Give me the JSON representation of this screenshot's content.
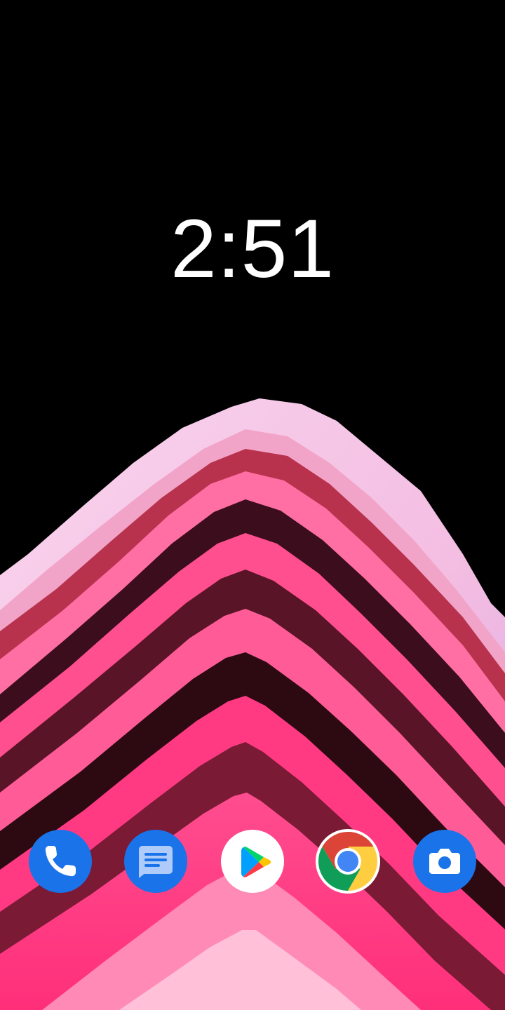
{
  "lockscreen": {
    "clock": "2:51"
  },
  "wallpaper": {
    "description_colors": {
      "background": "#000000",
      "rim": "#f6c6e6",
      "band_light": "#ff5a99",
      "band_dark": "#3a0b1a",
      "core": "#ff2f7a"
    }
  },
  "dock": {
    "apps": [
      {
        "name": "Phone",
        "icon": "phone-icon",
        "color": "#1a73e8"
      },
      {
        "name": "Messages",
        "icon": "messages-icon",
        "color": "#1a73e8"
      },
      {
        "name": "Play Store",
        "icon": "play-store-icon",
        "color": "#ffffff"
      },
      {
        "name": "Chrome",
        "icon": "chrome-icon",
        "color": "#ffffff"
      },
      {
        "name": "Camera",
        "icon": "camera-icon",
        "color": "#1a73e8"
      }
    ]
  }
}
